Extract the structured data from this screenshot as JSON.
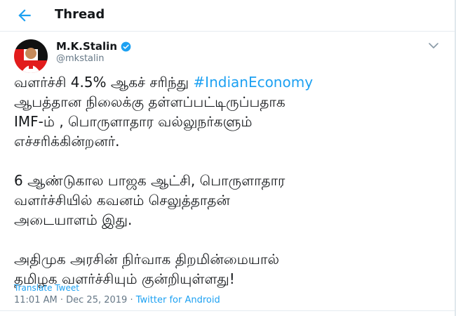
{
  "header": {
    "title": "Thread",
    "back_icon": "arrow-left-icon"
  },
  "tweet": {
    "author": {
      "name": "M.K.Stalin",
      "handle": "@mkstalin",
      "verified": true,
      "avatar_colors": {
        "bg": "#e21c1c",
        "accent": "#111111"
      }
    },
    "text": {
      "line1_pre": "வளர்ச்சி 4.5% ஆகச் சரிந்து ",
      "hashtag": "#IndianEconomy",
      "para1_rest": " ஆபத்தான நிலைக்கு தள்ளப்பட்டிருப்பதாக\nIMF-ம் , பொருளாதார வல்லுநர்களும்\nஎச்சரிக்கின்றனர்.",
      "para2": "6 ஆண்டுகால பாஜக ஆட்சி, பொருளாதார\nவளர்ச்சியில் கவனம் செலுத்தாதன்\nஅடையாளம் இது.",
      "para3": "அதிமுக அரசின் நிர்வாக திறமின்மையால்\nதமிழக வளர்ச்சியும் குன்றியுள்ளது!"
    },
    "translate_label": "Translate Tweet",
    "time": "11:01 AM",
    "date": "Dec 25, 2019",
    "separator": "·",
    "source": "Twitter for Android"
  },
  "colors": {
    "accent": "#1da1f2",
    "muted": "#657786",
    "text": "#14171a"
  }
}
